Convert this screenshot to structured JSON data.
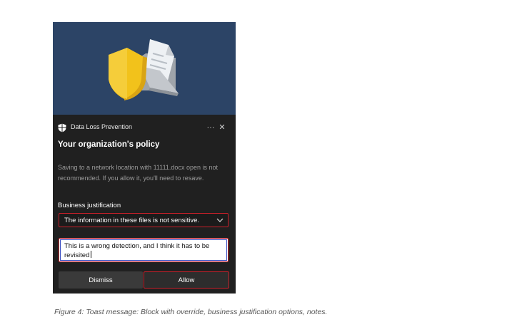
{
  "toast": {
    "app_name": "Data Loss Prevention",
    "more_icon": "more-icon",
    "close_icon": "close-icon",
    "more_glyph": "···",
    "close_glyph": "✕",
    "title": "Your organization's policy",
    "message": "Saving to a network location with 11111.docx open is not recommended. If you allow it, you'll need to resave.",
    "justification_label": "Business justification",
    "justification_selected": "The information in these files is not sensitive.",
    "notes_value": "This is a wrong detection, and I think it has to be revisited",
    "dismiss_label": "Dismiss",
    "allow_label": "Allow"
  },
  "caption": "Figure 4: Toast message: Block with override, business justification options, notes.",
  "colors": {
    "hero_bg": "#2c4466",
    "toast_bg": "#202020",
    "highlight": "#c8202a",
    "shield": "#f0c020"
  }
}
